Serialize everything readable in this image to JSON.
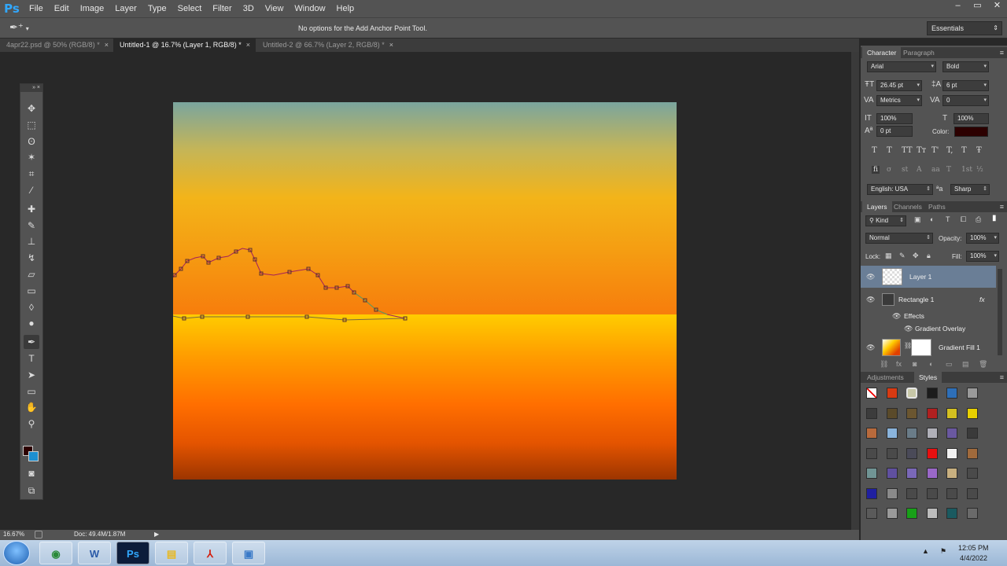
{
  "app": {
    "logo": "Ps"
  },
  "menubar": [
    "File",
    "Edit",
    "Image",
    "Layer",
    "Type",
    "Select",
    "Filter",
    "3D",
    "View",
    "Window",
    "Help"
  ],
  "window_controls": [
    "–",
    "▭",
    "✕"
  ],
  "options_bar": {
    "message": "No options for the Add Anchor Point Tool.",
    "workspace": "Essentials"
  },
  "tabs": [
    {
      "label": "4apr22.psd @ 50% (RGB/8) *",
      "close": "×"
    },
    {
      "label": "Untitled-1 @ 16.7% (Layer 1, RGB/8) *",
      "close": "×"
    },
    {
      "label": "Untitled-2 @ 66.7% (Layer 2, RGB/8) *",
      "close": "×"
    }
  ],
  "toolbox": {
    "header": "»  ×",
    "tools": [
      {
        "name": "move-tool",
        "glyph": "✥"
      },
      {
        "name": "marquee-tool",
        "glyph": "⬚"
      },
      {
        "name": "lasso-tool",
        "glyph": "ʘ"
      },
      {
        "name": "quick-select-tool",
        "glyph": "✶"
      },
      {
        "name": "crop-tool",
        "glyph": "⌗"
      },
      {
        "name": "eyedropper-tool",
        "glyph": "⁄"
      },
      {
        "name": "healing-brush-tool",
        "glyph": "✚"
      },
      {
        "name": "brush-tool",
        "glyph": "✎"
      },
      {
        "name": "clone-stamp-tool",
        "glyph": "⊥"
      },
      {
        "name": "history-brush-tool",
        "glyph": "↯"
      },
      {
        "name": "eraser-tool",
        "glyph": "▱"
      },
      {
        "name": "gradient-tool",
        "glyph": "▭"
      },
      {
        "name": "blur-tool",
        "glyph": "◊"
      },
      {
        "name": "dodge-tool",
        "glyph": "●"
      },
      {
        "name": "pen-tool",
        "glyph": "✒"
      },
      {
        "name": "type-tool",
        "glyph": "T"
      },
      {
        "name": "path-select-tool",
        "glyph": "➤"
      },
      {
        "name": "shape-tool",
        "glyph": "▭"
      },
      {
        "name": "hand-tool",
        "glyph": "✋"
      },
      {
        "name": "zoom-tool",
        "glyph": "⚲"
      }
    ],
    "mode_glyphs": [
      "◙",
      "⧉"
    ],
    "fg_color": "#2c0000",
    "bg_color": "#1d8fd1"
  },
  "status": {
    "zoom": "16.67%",
    "doc": "Doc: 49.4M/1.87M",
    "arrow": "▶"
  },
  "character_panel": {
    "tabs": [
      "Character",
      "Paragraph"
    ],
    "font_family": "Arial",
    "font_style": "Bold",
    "font_size": "26.45 pt",
    "leading": "6 pt",
    "kerning": "Metrics",
    "tracking": "0",
    "vscale": "100%",
    "hscale": "100%",
    "baseline": "0 pt",
    "color_label": "Color:",
    "color": "#2c0000",
    "type_buttons": [
      "T",
      "T",
      "TT",
      "Tт",
      "T'",
      "T,",
      "T",
      "Ŧ"
    ],
    "opentype_buttons": [
      "fi",
      "σ",
      "st",
      "A",
      "aa",
      "T",
      "1st",
      "½"
    ],
    "language": "English: USA",
    "aa_label": "a",
    "antialias": "Sharp"
  },
  "layers_panel": {
    "tabs": [
      "Layers",
      "Channels",
      "Paths"
    ],
    "kind": "Kind",
    "blend_mode": "Normal",
    "opacity_label": "Opacity:",
    "opacity": "100%",
    "lock_label": "Lock:",
    "fill_label": "Fill:",
    "fill": "100%",
    "layers": [
      {
        "name": "Layer 1",
        "selected": true
      },
      {
        "name": "Rectangle 1",
        "fx": "fx"
      },
      {
        "name": "Effects"
      },
      {
        "name": "Gradient Overlay"
      },
      {
        "name": "Gradient Fill 1"
      }
    ],
    "footer_icons": [
      "⛓",
      "fx",
      "◙",
      "◐",
      "▭",
      "▤",
      "🗑"
    ]
  },
  "styles_panel": {
    "tabs": [
      "Adjustments",
      "Styles"
    ],
    "swatches": [
      "#ffffff",
      "#d83a12",
      "#c8c8a8",
      "#1c1c1c",
      "#2e6fb8",
      "#9a9a9a",
      "#3c3c3c",
      "#5a4a2a",
      "#6b5630",
      "#b02020",
      "#d4c020",
      "#e8d000",
      "#b86a3c",
      "#8ab4dc",
      "#6a7c88",
      "#b0b0b8",
      "#6a58a0",
      "#3a3a3a",
      "#4a4a4a",
      "#4a4a4a",
      "#4a4a58",
      "#e81010",
      "#f2f2f2",
      "#a06a3c",
      "#709494",
      "#6050a0",
      "#7a68b8",
      "#9a68c8",
      "#c8b080",
      "#4a4a4a",
      "#2020a0",
      "#8a8a8a",
      "#4a4a4a",
      "#4a4a4a",
      "#4a4a4a",
      "#4a4a4a",
      "#5a5a5a",
      "#9a9a9a",
      "#18a018",
      "#bcbcbc",
      "#1a5a60",
      "#6a6a6a"
    ]
  },
  "taskbar": {
    "apps": [
      {
        "name": "chrome",
        "glyph": "◉",
        "color": "#2a8a3a"
      },
      {
        "name": "word",
        "glyph": "W",
        "color": "#2b5aa8"
      },
      {
        "name": "photoshop",
        "glyph": "Ps",
        "color": "#31a8ff"
      },
      {
        "name": "explorer",
        "glyph": "▤",
        "color": "#e8b820"
      },
      {
        "name": "acrobat",
        "glyph": "⅄",
        "color": "#d42010"
      },
      {
        "name": "photos",
        "glyph": "▣",
        "color": "#3a7ac8"
      }
    ],
    "tray_arrow": "▲",
    "tray_flag": "⚑",
    "time": "12:05 PM",
    "date": "4/4/2022"
  }
}
